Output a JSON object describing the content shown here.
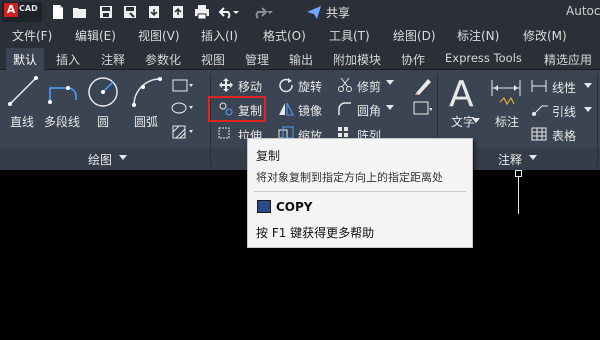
{
  "app": {
    "logo_letter": "A",
    "logo_text": "CAD",
    "title": "Autoc"
  },
  "quick_access": {
    "share_label": "共享",
    "icons": [
      "new-icon",
      "open-icon",
      "save-icon",
      "save-as-icon",
      "cloud-open-icon",
      "cloud-save-icon",
      "print-icon",
      "undo-icon",
      "redo-icon",
      "share-icon"
    ]
  },
  "menu": [
    "文件(F)",
    "编辑(E)",
    "视图(V)",
    "插入(I)",
    "格式(O)",
    "工具(T)",
    "绘图(D)",
    "标注(N)",
    "修改(M)"
  ],
  "tabs": [
    "默认",
    "插入",
    "注释",
    "参数化",
    "视图",
    "管理",
    "输出",
    "附加模块",
    "协作",
    "Express Tools",
    "精选应用"
  ],
  "ribbon": {
    "draw": {
      "line": "直线",
      "polyline": "多段线",
      "circle": "圆",
      "arc": "圆弧",
      "panel": "绘图"
    },
    "modify": {
      "move": "移动",
      "rotate": "旋转",
      "trim": "修剪",
      "copy": "复制",
      "mirror": "镜像",
      "fillet": "圆角",
      "stretch": "拉伸",
      "scale": "缩放",
      "array": "阵列"
    },
    "annotation": {
      "text": "文字",
      "dimension": "标注",
      "linear": "线性",
      "leader": "引线",
      "table": "表格",
      "panel": "注释"
    }
  },
  "tooltip": {
    "title": "复制",
    "description": "将对象复制到指定方向上的指定距离处",
    "command": "COPY",
    "help": "按 F1 键获得更多帮助"
  }
}
